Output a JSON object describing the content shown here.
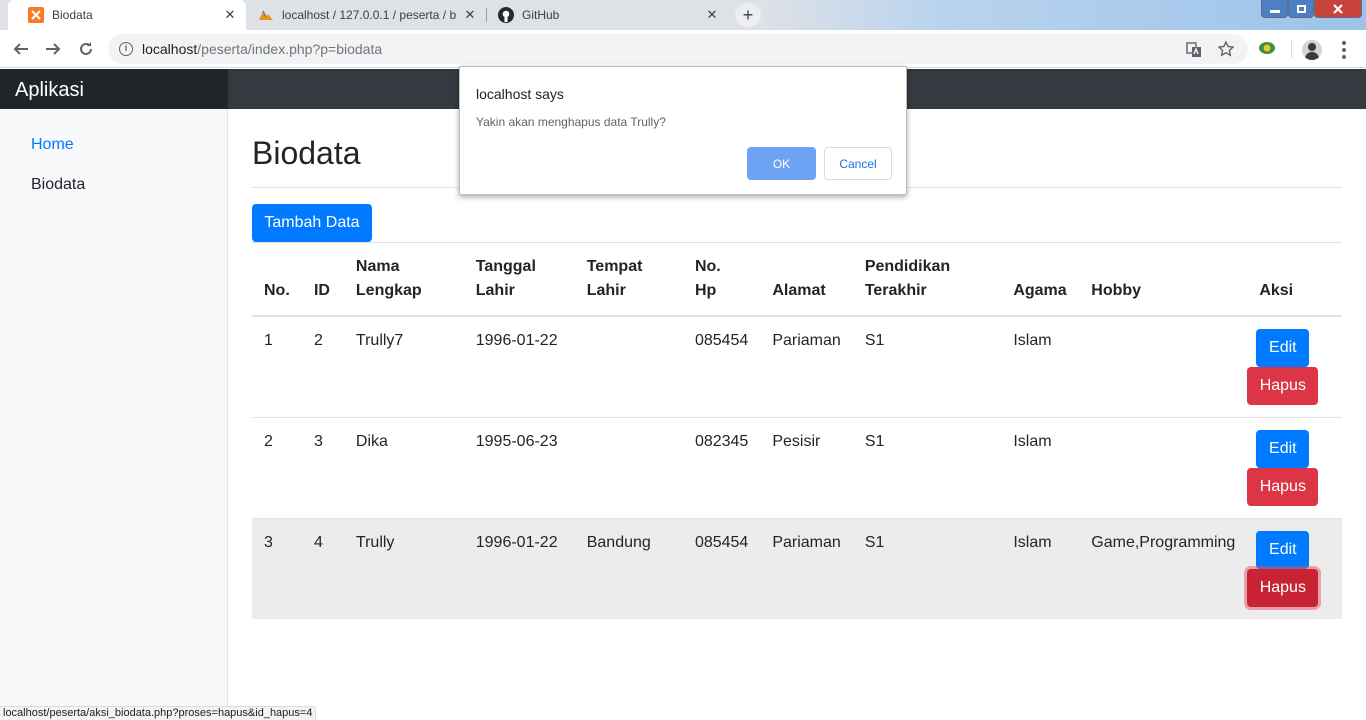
{
  "browser": {
    "tabs": [
      {
        "title": "Biodata",
        "active": true
      },
      {
        "title": "localhost / 127.0.0.1 / peserta / b",
        "active": false
      },
      {
        "title": "GitHub",
        "active": false
      }
    ],
    "tab_close": "✕",
    "new_tab": "+",
    "url_host": "localhost",
    "url_path": "/peserta/index.php?p=biodata",
    "status_url": "localhost/peserta/aksi_biodata.php?proses=hapus&id_hapus=4"
  },
  "app": {
    "brand": "Aplikasi",
    "sidebar": [
      {
        "label": "Home",
        "color": "#007bff"
      },
      {
        "label": "Biodata",
        "color": "#212529"
      }
    ],
    "page_title": "Biodata",
    "add_button": "Tambah Data",
    "table": {
      "headers": [
        "No.",
        "ID",
        "Nama\nLengkap",
        "Tanggal\nLahir",
        "Tempat\nLahir",
        "No.\nHp",
        "Alamat",
        "Pendidikan\nTerakhir",
        "Agama",
        "Hobby",
        "Aksi"
      ],
      "rows": [
        [
          "1",
          "2",
          "Trully7",
          "1996-01-22",
          "",
          "085454",
          "Pariaman",
          "S1",
          "Islam",
          ""
        ],
        [
          "2",
          "3",
          "Dika",
          "1995-06-23",
          "",
          "082345",
          "Pesisir",
          "S1",
          "Islam",
          ""
        ],
        [
          "3",
          "4",
          "Trully",
          "1996-01-22",
          "Bandung",
          "085454",
          "Pariaman",
          "S1",
          "Islam",
          "Game,Programming"
        ]
      ],
      "edit_label": "Edit",
      "delete_label": "Hapus"
    }
  },
  "dialog": {
    "title": "localhost says",
    "message": "Yakin akan menghapus data Trully?",
    "ok": "OK",
    "cancel": "Cancel"
  },
  "colors": {
    "primary": "#007bff",
    "danger": "#dc3545",
    "navbar": "#343a40"
  }
}
